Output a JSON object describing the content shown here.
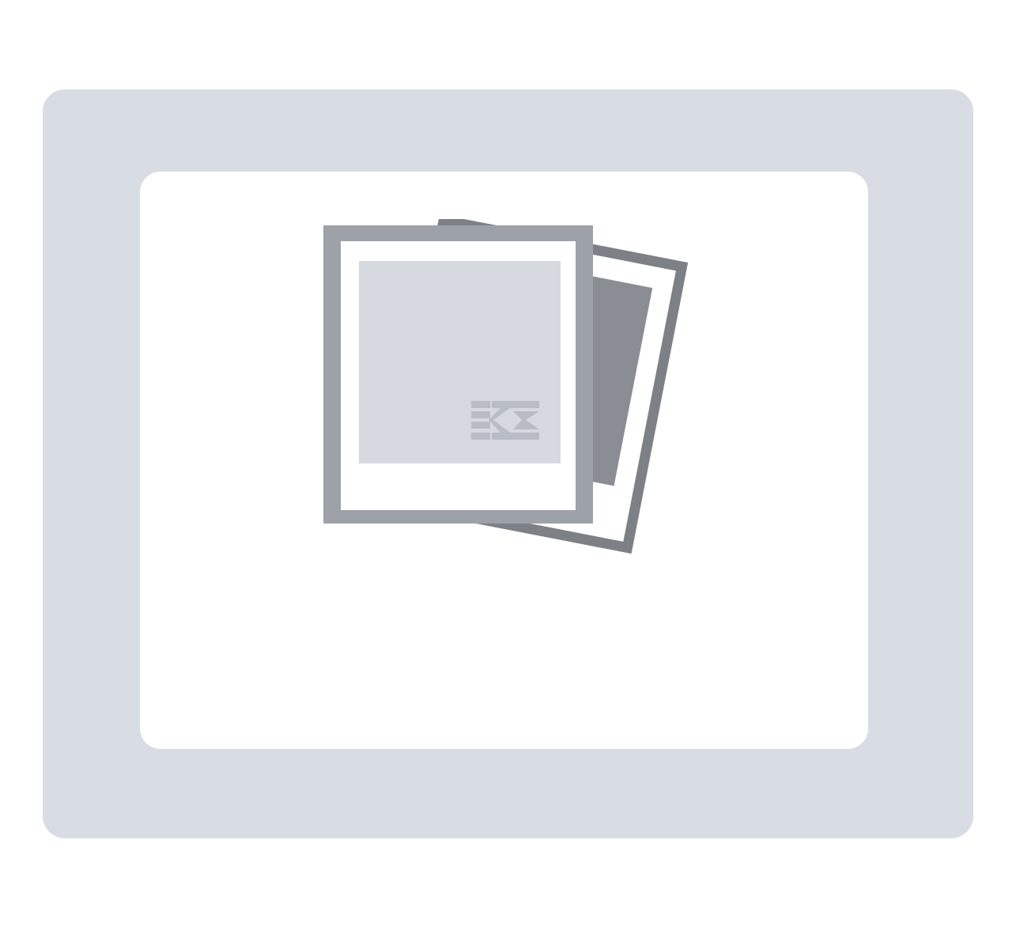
{
  "placeholder": {
    "icon": "photo-stack-icon",
    "watermark_icon": "k-logo-icon"
  },
  "colors": {
    "frame": "#d8dce3",
    "panel": "#ffffff",
    "icon_dark": "#7d8086",
    "icon_mid": "#9da1a8",
    "photo_fill": "#d6d9e0",
    "back_photo_fill": "#8a8d93",
    "watermark": "#b8bcc4"
  }
}
